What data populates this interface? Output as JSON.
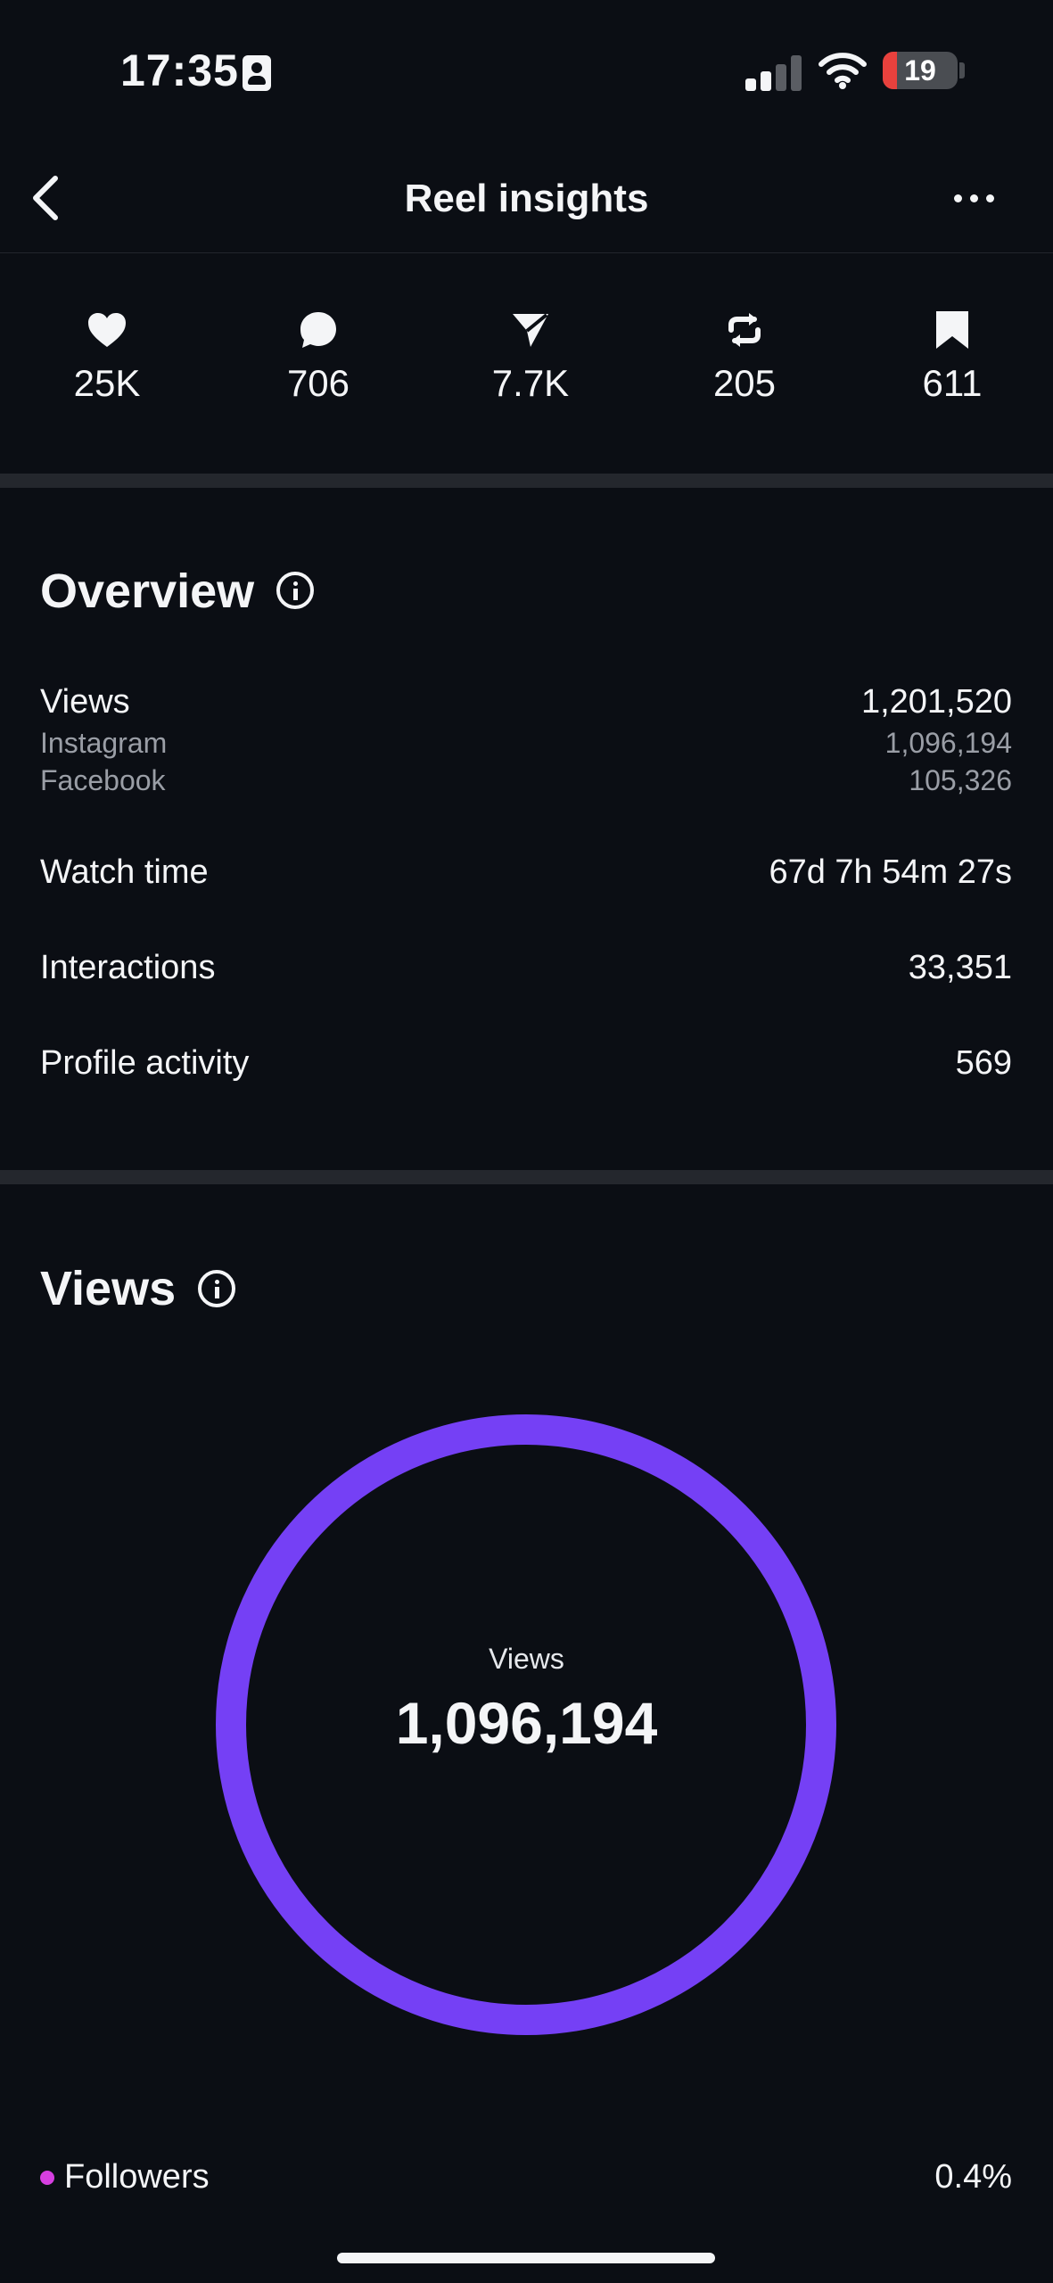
{
  "status_bar": {
    "time": "17:35",
    "battery_level": "19",
    "battery_color": "#e8413d"
  },
  "header": {
    "title": "Reel insights",
    "back_icon": "chevron-left-icon",
    "more_icon": "more-horizontal-icon"
  },
  "stats": [
    {
      "icon": "heart-icon",
      "value": "25K"
    },
    {
      "icon": "comment-icon",
      "value": "706"
    },
    {
      "icon": "send-icon",
      "value": "7.7K"
    },
    {
      "icon": "repost-icon",
      "value": "205"
    },
    {
      "icon": "bookmark-icon",
      "value": "611"
    }
  ],
  "overview": {
    "title": "Overview",
    "views_label": "Views",
    "views_value": "1,201,520",
    "instagram_label": "Instagram",
    "instagram_value": "1,096,194",
    "facebook_label": "Facebook",
    "facebook_value": "105,326",
    "watch_time_label": "Watch time",
    "watch_time_value": "67d 7h 54m 27s",
    "interactions_label": "Interactions",
    "interactions_value": "33,351",
    "profile_activity_label": "Profile activity",
    "profile_activity_value": "569"
  },
  "views_section": {
    "title": "Views",
    "donut_label": "Views",
    "donut_value": "1,096,194",
    "donut_color": "#7540f5",
    "legend": [
      {
        "label": "Followers",
        "value": "0.4%",
        "color": "#d63fe0"
      }
    ]
  }
}
